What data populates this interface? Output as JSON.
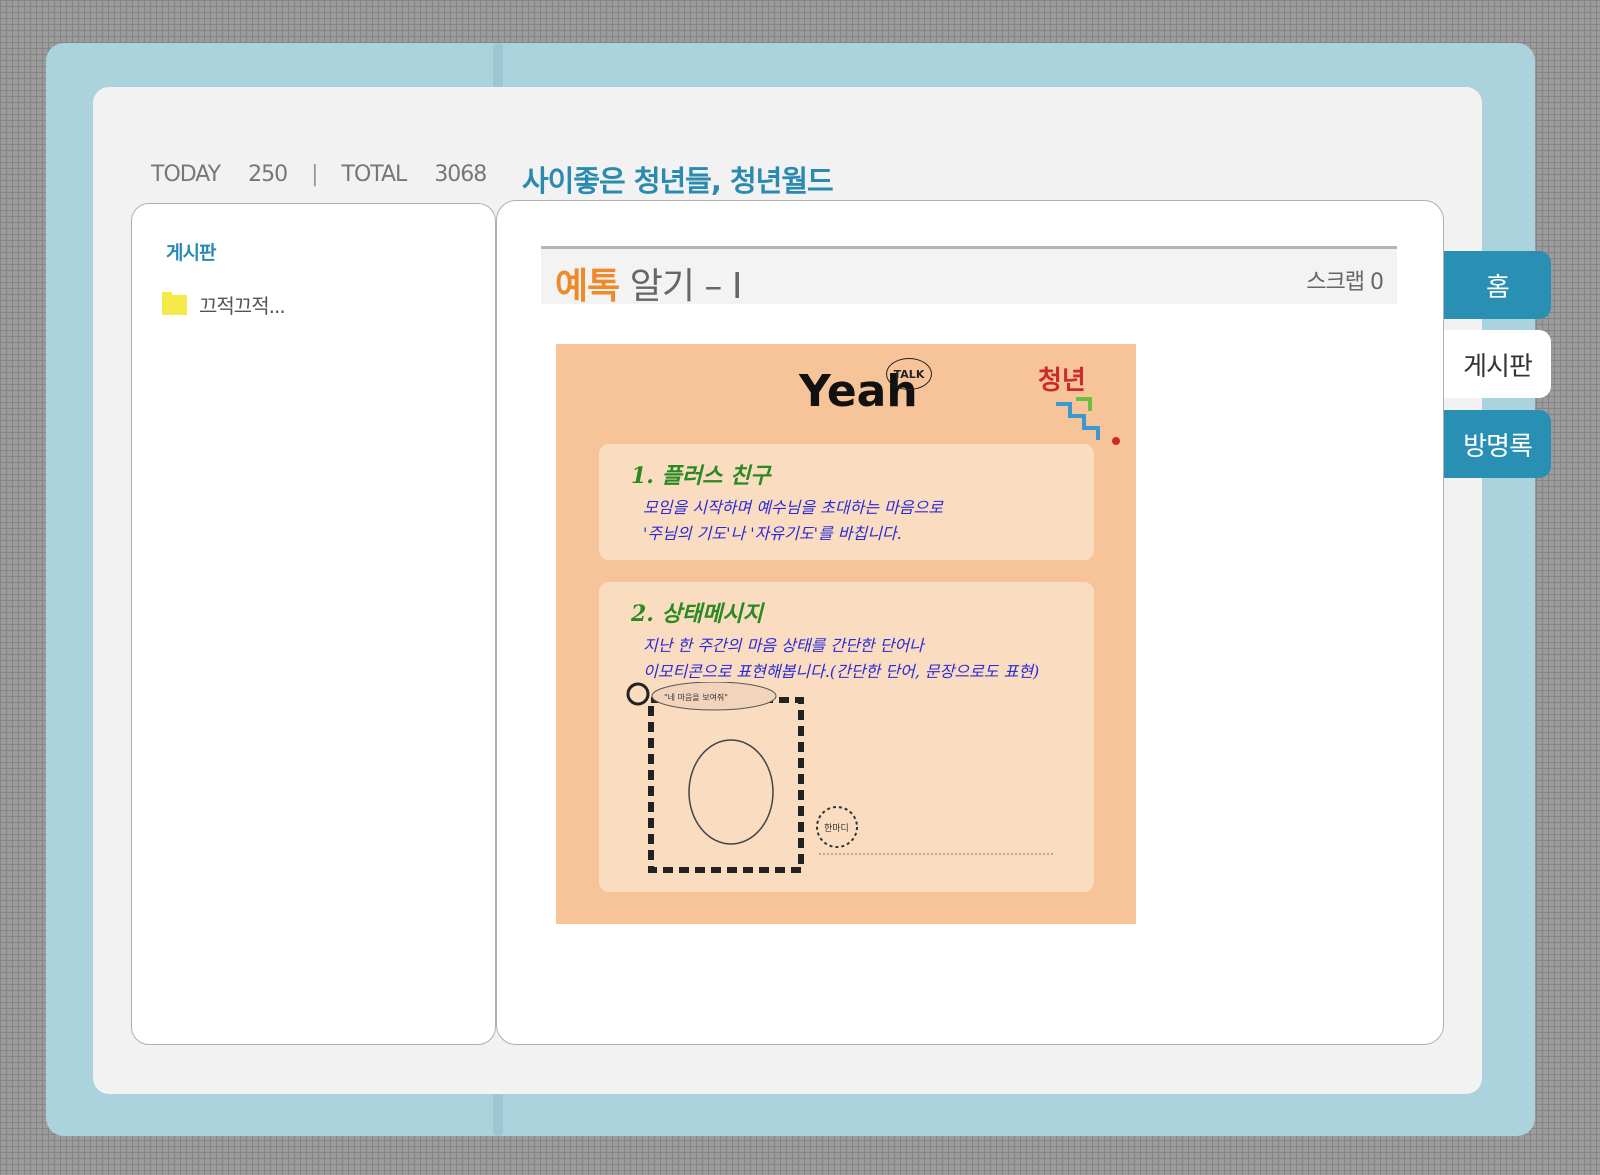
{
  "colors": {
    "frame": "#abd3dd",
    "accent_blue": "#2a8ab0",
    "tab_blue": "#2a90b3",
    "accent_orange": "#ee8a2a",
    "image_bg": "#f7c399",
    "card_bg": "#fadcc0",
    "heading_green": "#2a8a22",
    "text_blue": "#2a2ad8"
  },
  "counter": {
    "today_label": "TODAY",
    "today_value": "250",
    "separator": "|",
    "total_label": "TOTAL",
    "total_value": "3068"
  },
  "site_title": "사이좋은 청년들, 청년월드",
  "sidebar": {
    "section_label": "게시판",
    "items": [
      {
        "icon": "folder-icon",
        "label": "끄적끄적..."
      }
    ]
  },
  "post": {
    "title_accent": "예톡",
    "title_rest": " 알기 – Ⅰ",
    "scrap_label": "스크랩 0",
    "image": {
      "title": "Yeah",
      "badge": "TALK",
      "logo_text": "청년",
      "card1": {
        "heading": "1. 플러스 친구",
        "line1": "모임을 시작하며 예수님을 초대하는 마음으로",
        "line2": "'주님의 기도'나 '자유기도'를 바칩니다."
      },
      "card2": {
        "heading": "2. 상태메시지",
        "line1": "지난 한 주간의 마음 상태를 간단한 단어나",
        "line2": "이모티콘으로 표현해봅니다.(간단한 단어, 문장으로도 표현)",
        "bubble_text": "\"네 마음을 보여줘\"",
        "stamp_text": "한마디"
      }
    }
  },
  "tabs": [
    {
      "label": "홈"
    },
    {
      "label": "게시판"
    },
    {
      "label": "방명록"
    }
  ]
}
